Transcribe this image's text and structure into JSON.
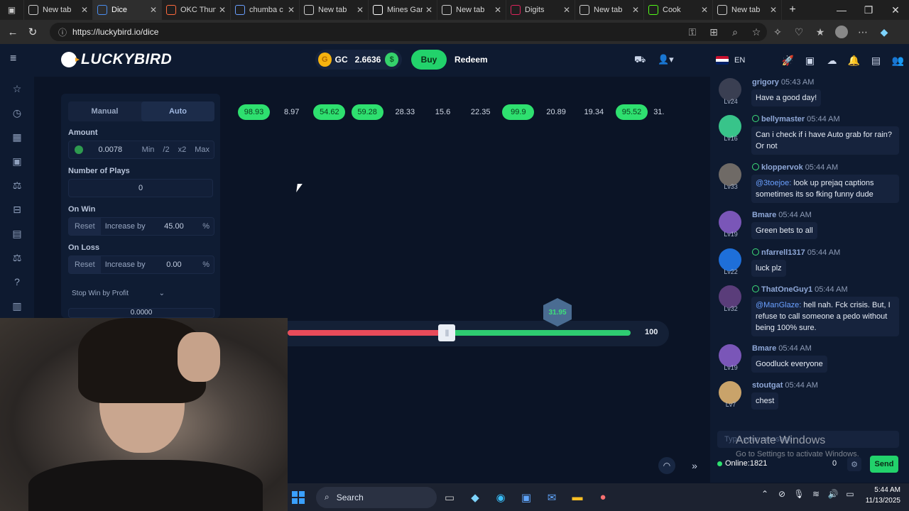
{
  "browser": {
    "tabs": [
      {
        "label": "New tab",
        "icon": "newtab-icon",
        "color": "#cccccc"
      },
      {
        "label": "Dice",
        "icon": "luckybird-favicon",
        "color": "#4a8ef0",
        "active": true
      },
      {
        "label": "OKC Thun",
        "icon": "okc-favicon",
        "color": "#ff6a3d"
      },
      {
        "label": "chumba c",
        "icon": "search-icon",
        "color": "#6aa0ff"
      },
      {
        "label": "New tab",
        "icon": "newtab-icon",
        "color": "#cccccc"
      },
      {
        "label": "Mines Gar",
        "icon": "stake-favicon",
        "color": "#ffffff"
      },
      {
        "label": "New tab",
        "icon": "newtab-icon",
        "color": "#cccccc"
      },
      {
        "label": "Digits",
        "icon": "record-icon",
        "color": "#e0245e"
      },
      {
        "label": "New tab",
        "icon": "newtab-icon",
        "color": "#cccccc"
      },
      {
        "label": "Cook",
        "icon": "kick-favicon",
        "color": "#53fc18"
      },
      {
        "label": "New tab",
        "icon": "newtab-icon",
        "color": "#cccccc"
      }
    ],
    "url": "https://luckybird.io/dice"
  },
  "header": {
    "logo": "LUCKYBIRD",
    "currency": "GC",
    "balance": "2.6636",
    "buy_label": "Buy",
    "redeem_label": "Redeem",
    "language": "EN"
  },
  "panel": {
    "modes": [
      "Manual",
      "Auto"
    ],
    "amount_label": "Amount",
    "amount_value": "0.0078",
    "amount_buttons": [
      "Min",
      "/2",
      "x2",
      "Max"
    ],
    "plays_label": "Number of Plays",
    "plays_value": "0",
    "on_win_label": "On Win",
    "on_win_reset": "Reset",
    "on_win_mode": "Increase by",
    "on_win_value": "45.00",
    "on_loss_label": "On Loss",
    "on_loss_reset": "Reset",
    "on_loss_mode": "Increase by",
    "on_loss_value": "0.00",
    "percent": "%",
    "stop_win_label": "Stop Win by Profit",
    "stop_win_value": "0.0000"
  },
  "results": [
    {
      "value": "98.93",
      "win": true
    },
    {
      "value": "8.97",
      "win": false
    },
    {
      "value": "54.62",
      "win": true
    },
    {
      "value": "59.28",
      "win": true
    },
    {
      "value": "28.33",
      "win": false
    },
    {
      "value": "15.6",
      "win": false
    },
    {
      "value": "22.35",
      "win": false
    },
    {
      "value": "99.9",
      "win": true
    },
    {
      "value": "20.89",
      "win": false
    },
    {
      "value": "19.34",
      "win": false
    },
    {
      "value": "95.52",
      "win": true
    },
    {
      "value": "31.",
      "win": false
    }
  ],
  "slider": {
    "max_label": "100",
    "last_roll": "31.95",
    "red_fraction": 0.465
  },
  "chat": {
    "messages": [
      {
        "user": "grigory",
        "time": "05:43 AM",
        "level": "Lv24",
        "verified": false,
        "text": "Have a good day!",
        "mention": "",
        "color": "#8fa8d8",
        "avatar": "#3a3f52"
      },
      {
        "user": "bellymaster",
        "time": "05:44 AM",
        "level": "Lv16",
        "verified": true,
        "text": "Can i check if i have Auto grab for rain? Or not",
        "mention": "",
        "color": "#8fa8d8",
        "avatar": "#38c48a"
      },
      {
        "user": "kloppervok",
        "time": "05:44 AM",
        "level": "Lv33",
        "verified": true,
        "text": "look up prejaq captions sometimes its so fking funny dude",
        "mention": "@3toejoe:",
        "color": "#8fa8d8",
        "avatar": "#6f6a66"
      },
      {
        "user": "Bmare",
        "time": "05:44 AM",
        "level": "Lv19",
        "verified": false,
        "text": "Green bets to all",
        "mention": "",
        "color": "#8fa8d8",
        "avatar": "#7a56b8"
      },
      {
        "user": "nfarrell1317",
        "time": "05:44 AM",
        "level": "Lv22",
        "verified": true,
        "text": "luck plz",
        "mention": "",
        "color": "#8fa8d8",
        "avatar": "#1e6fd9"
      },
      {
        "user": "ThatOneGuy1",
        "time": "05:44 AM",
        "level": "Lv32",
        "verified": true,
        "text": "hell nah. Fck crisis. But, I refuse to call someone a pedo without being 100% sure.",
        "mention": "@ManGlaze:",
        "color": "#8fa8d8",
        "avatar": "#5a3d7a"
      },
      {
        "user": "Bmare",
        "time": "05:44 AM",
        "level": "Lv19",
        "verified": false,
        "text": "Goodluck everyone",
        "mention": "",
        "color": "#8fa8d8",
        "avatar": "#7a56b8"
      },
      {
        "user": "stoutgat",
        "time": "05:44 AM",
        "level": "Lv7",
        "verified": false,
        "text": "chest",
        "mention": "",
        "color": "#8fa8d8",
        "avatar": "#c9a36a"
      }
    ],
    "input_placeholder": "Type your message",
    "online_label": "Online:1821",
    "count": "0",
    "send_label": "Send"
  },
  "watermark": {
    "line1": "Activate Windows",
    "line2": "Go to Settings to activate Windows."
  },
  "taskbar": {
    "search_label": "Search",
    "time": "5:44 AM",
    "date": "11/13/2025"
  }
}
